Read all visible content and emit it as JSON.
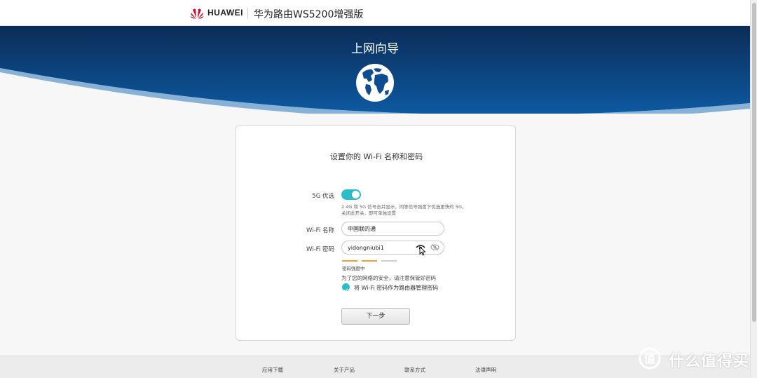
{
  "header": {
    "brand": "HUAWEI",
    "product_name": "华为路由WS5200增强版",
    "logo_icon": "huawei-logo",
    "logo_color": "#cf0a2c"
  },
  "banner": {
    "title": "上网向导",
    "icon": "globe-icon",
    "gradient": [
      "#0b2c57",
      "#0d5aa2"
    ]
  },
  "card": {
    "title": "设置你的 Wi-Fi 名称和密码",
    "prefer_5g": {
      "label": "5G 优选",
      "enabled": true,
      "hint": "2.4G 和 5G 信号合并显示，同等信号强度下优选更快的 5G，关闭此开关，即可单独设置"
    },
    "wifi_name": {
      "label": "Wi-Fi 名称",
      "value": "中国联的通"
    },
    "wifi_password": {
      "label": "Wi-Fi 密码",
      "value": "yidongniubi1",
      "show_icon": "eye-icon",
      "hide_icon": "eye-off-icon"
    },
    "strength": {
      "label": "密码强度中",
      "level": 2,
      "max": 3,
      "colors": [
        "#f0a030",
        "#f0a030",
        "#cfcfcf"
      ]
    },
    "security_note": "为了您的网络的安全，请注意保管好密码",
    "use_as_admin": {
      "checked": true,
      "label": "将 Wi-Fi 密码作为路由器管理密码"
    },
    "next_button": "下一步"
  },
  "footer": {
    "links": [
      "应用下载",
      "关于产品",
      "联系方式",
      "法律声明"
    ]
  },
  "watermark": {
    "text": "什么值得买",
    "icon": "smzdm-logo-icon"
  },
  "accent_color": "#2bbdc8"
}
